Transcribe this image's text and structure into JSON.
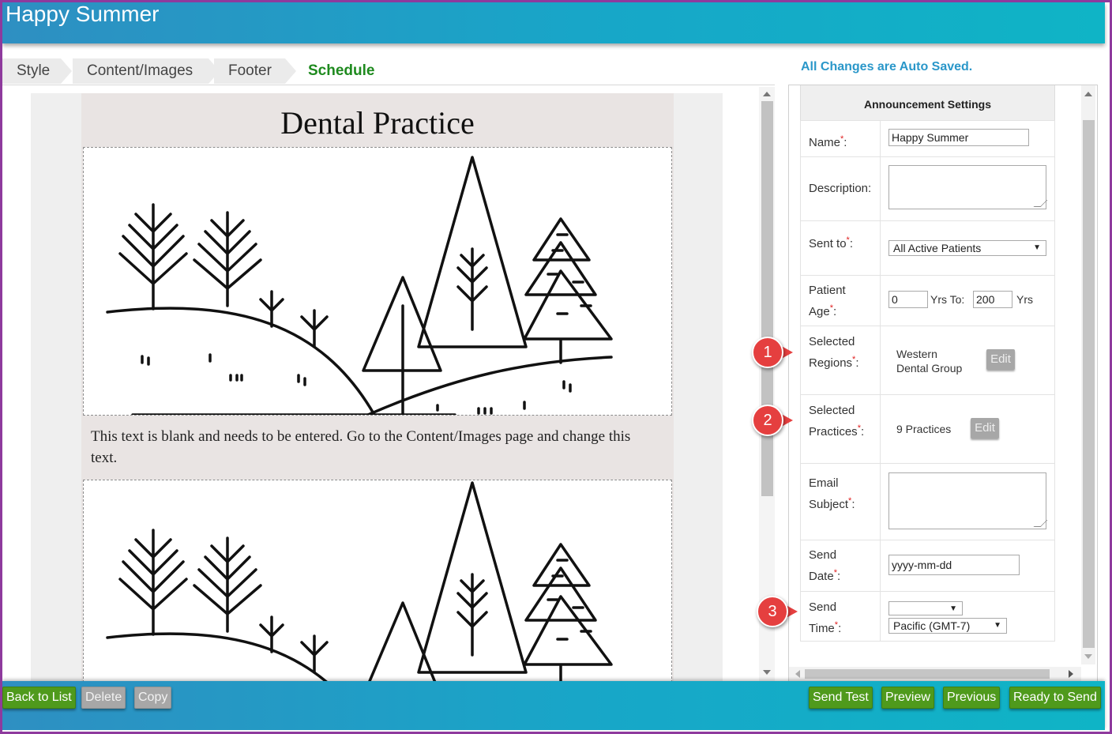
{
  "header": {
    "title": "Happy Summer"
  },
  "tabs": [
    {
      "label": "Style"
    },
    {
      "label": "Content/Images"
    },
    {
      "label": "Footer"
    },
    {
      "label": "Schedule"
    }
  ],
  "autosave_text": "All Changes are Auto Saved.",
  "preview": {
    "heading": "Dental Practice",
    "body_text": "This text is blank and needs to be entered. Go to the Content/Images page and change this text."
  },
  "settings": {
    "title": "Announcement Settings",
    "name": {
      "label": "Name",
      "value": "Happy Summer"
    },
    "description": {
      "label": "Description:",
      "value": ""
    },
    "sent_to": {
      "label": "Sent to",
      "value": "All Active Patients"
    },
    "patient_age": {
      "label_1": "Patient",
      "label_2": "Age",
      "from": "0",
      "yrs_to": "Yrs To:",
      "to": "200",
      "yrs": "Yrs"
    },
    "regions": {
      "label_1": "Selected",
      "label_2": "Regions",
      "value_1": "Western",
      "value_2": "Dental Group",
      "edit": "Edit"
    },
    "practices": {
      "label_1": "Selected",
      "label_2": "Practices",
      "value": "9 Practices",
      "edit": "Edit"
    },
    "email_subject": {
      "label_1": "Email",
      "label_2": "Subject",
      "value": ""
    },
    "send_date": {
      "label_1": "Send",
      "label_2": "Date",
      "placeholder": "yyyy-mm-dd"
    },
    "send_time": {
      "label_1": "Send",
      "label_2": "Time",
      "value": "",
      "timezone": "Pacific (GMT-7)"
    },
    "required_mark": "*",
    "colon": ":"
  },
  "callouts": [
    "1",
    "2",
    "3"
  ],
  "footer": {
    "back": "Back to List",
    "delete": "Delete",
    "copy": "Copy",
    "send_test": "Send Test",
    "preview": "Preview",
    "previous": "Previous",
    "ready": "Ready to Send"
  },
  "colors": {
    "accent_green": "#4f9a1c",
    "header_teal": "#17a7c8",
    "callout_red": "#e53f3f",
    "active_tab": "#1e8a1e"
  }
}
